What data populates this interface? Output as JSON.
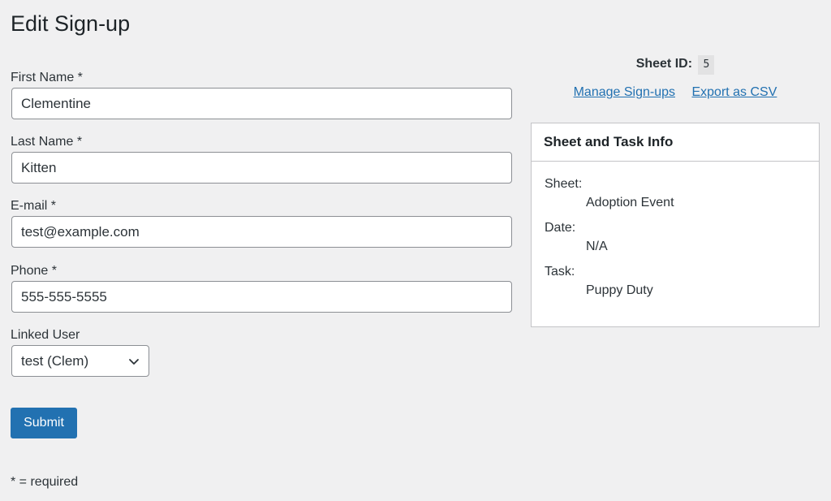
{
  "page": {
    "title": "Edit Sign-up"
  },
  "form": {
    "first_name": {
      "label": "First Name *",
      "value": "Clementine"
    },
    "last_name": {
      "label": "Last Name *",
      "value": "Kitten"
    },
    "email": {
      "label": "E-mail *",
      "value": "test@example.com"
    },
    "phone": {
      "label": "Phone *",
      "value": "555-555-5555"
    },
    "linked_user": {
      "label": "Linked User",
      "selected": "test (Clem)"
    },
    "submit_label": "Submit",
    "required_note": "* = required"
  },
  "sidebar": {
    "sheet_id_label": "Sheet ID:",
    "sheet_id_value": "5",
    "links": {
      "manage": "Manage Sign-ups",
      "export": "Export as CSV"
    },
    "info_box": {
      "title": "Sheet and Task Info",
      "items": [
        {
          "term": "Sheet:",
          "value": "Adoption Event"
        },
        {
          "term": "Date:",
          "value": "N/A"
        },
        {
          "term": "Task:",
          "value": "Puppy Duty"
        }
      ]
    }
  },
  "icons": {
    "select_arrow": "chevron-down-icon"
  },
  "colors": {
    "background": "#f0f0f1",
    "primary": "#2271b1",
    "text": "#1d2327",
    "border": "#8c8f94"
  }
}
